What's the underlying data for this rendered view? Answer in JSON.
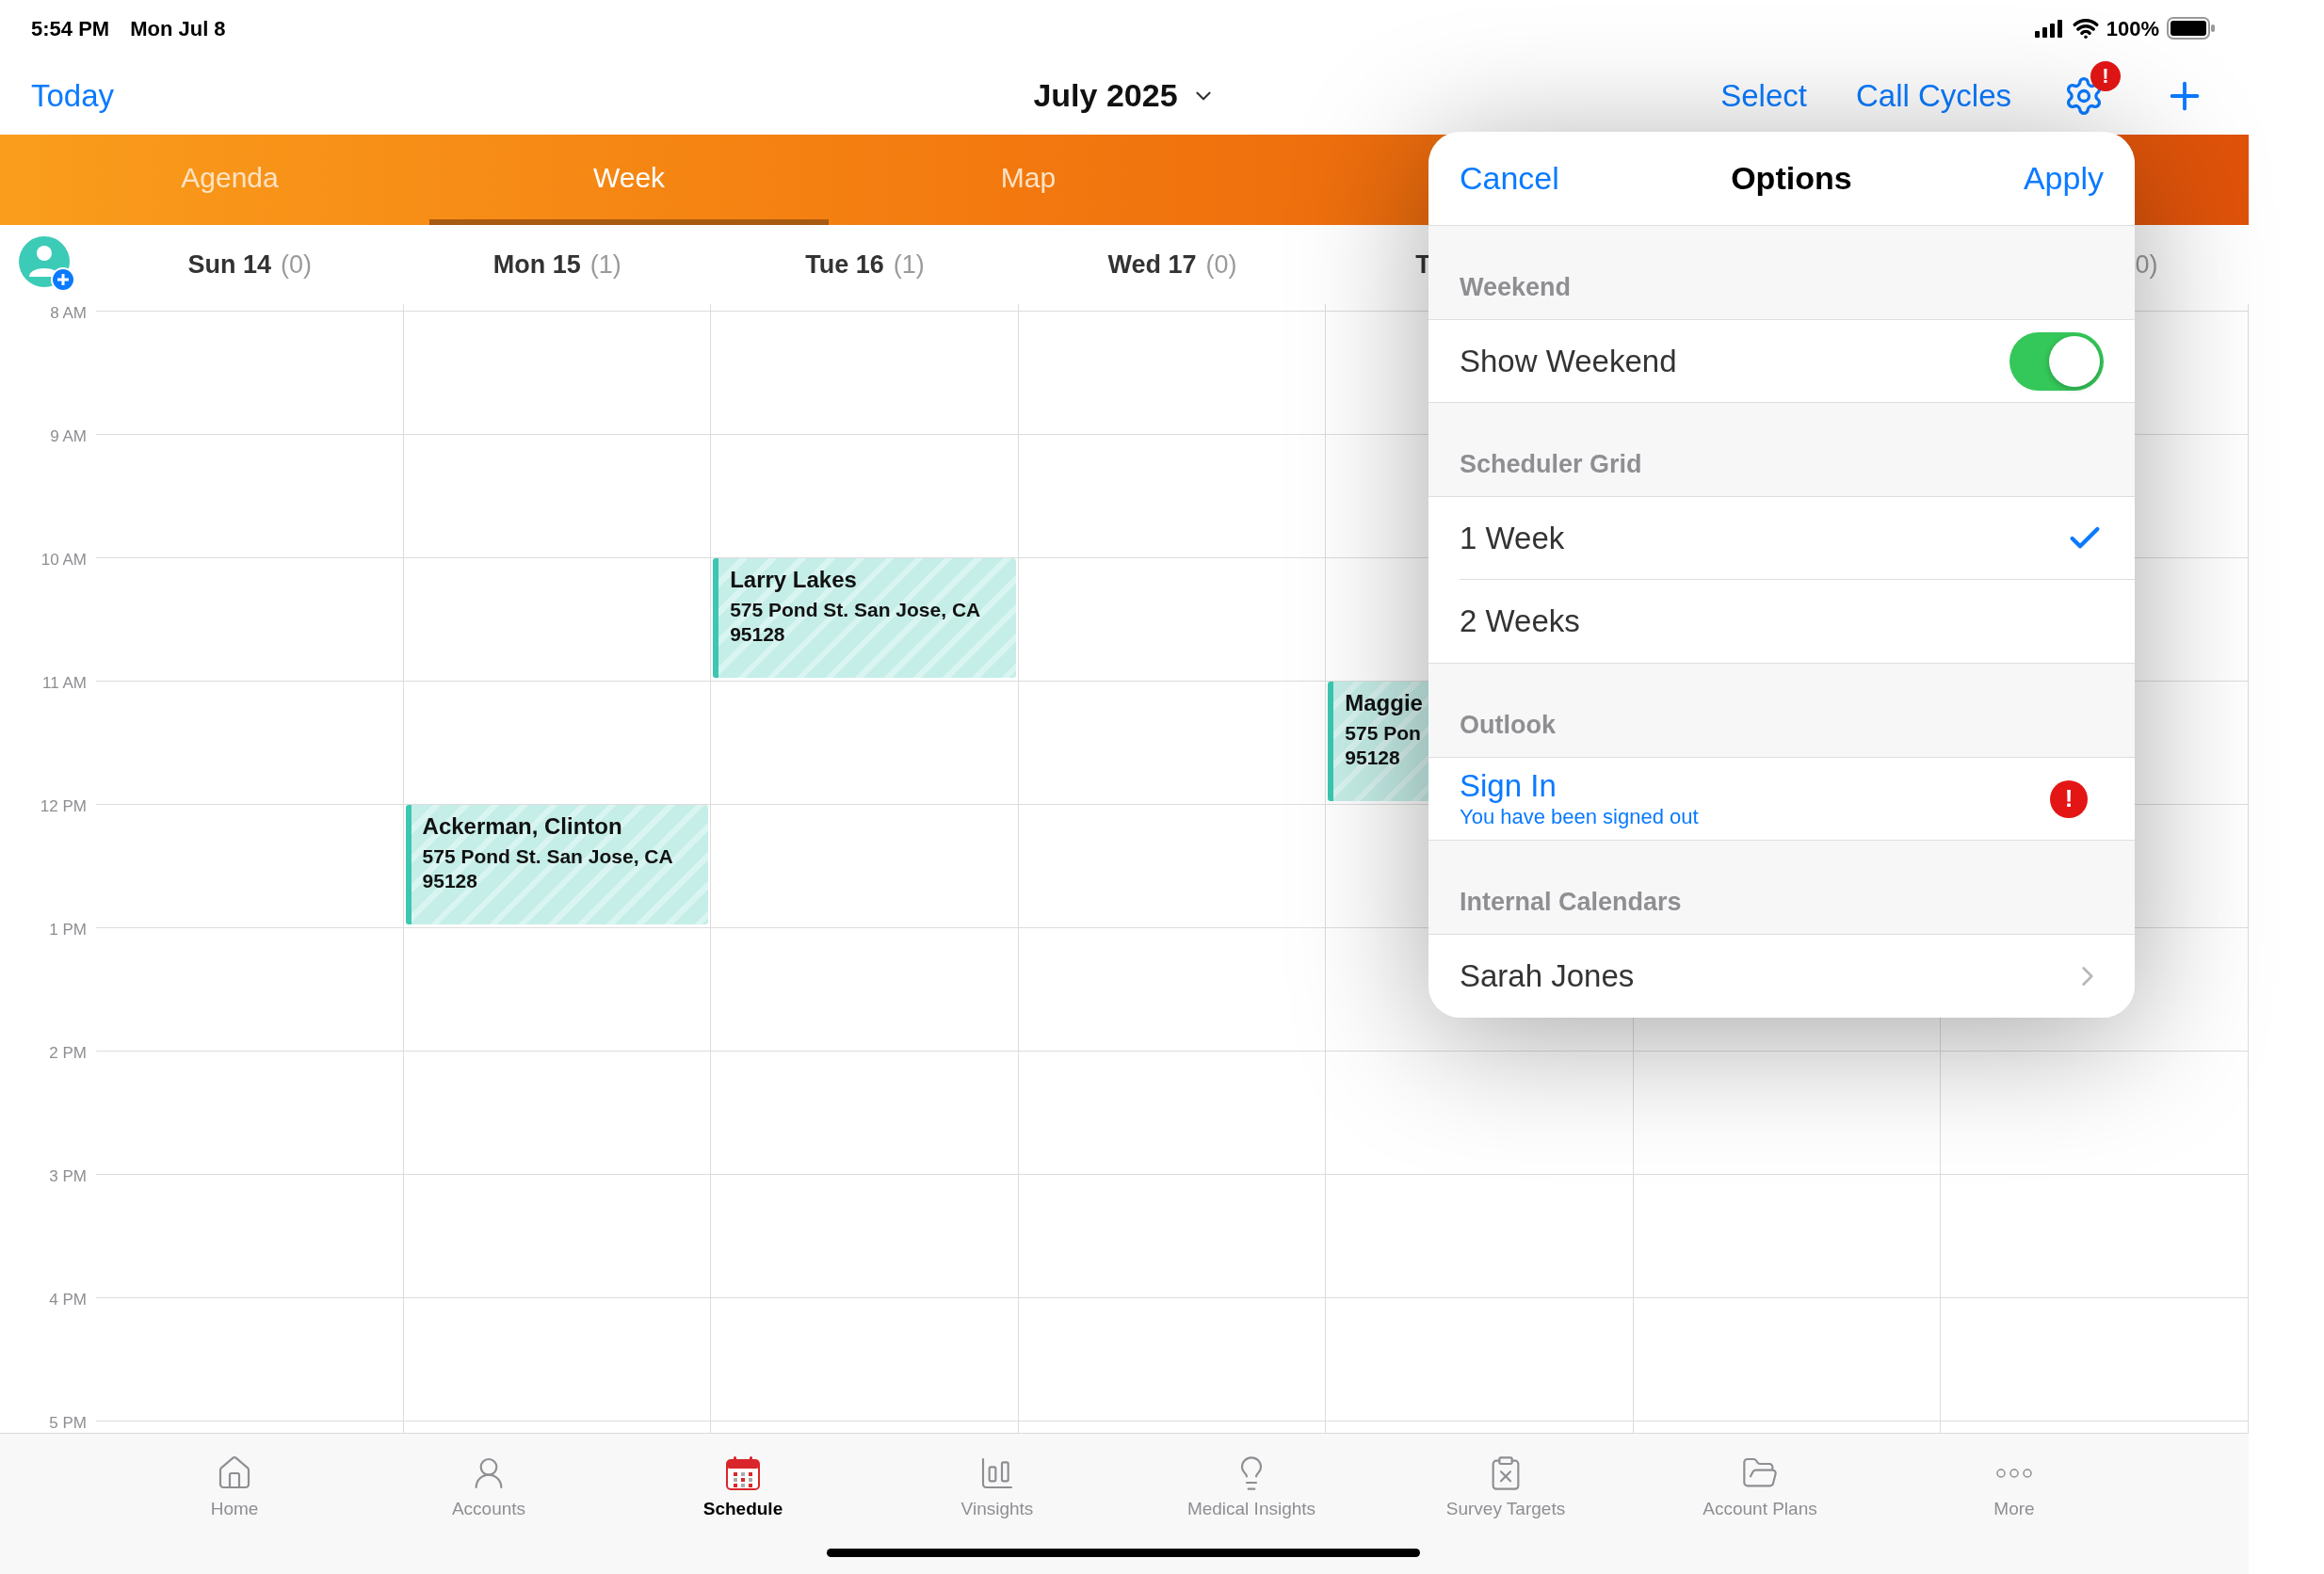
{
  "status_bar": {
    "time": "5:54 PM",
    "date": "Mon Jul 8",
    "battery": "100%"
  },
  "nav": {
    "today": "Today",
    "title": "July 2025",
    "actions": [
      "Select",
      "Call Cycles"
    ],
    "settings_alert": "!"
  },
  "view_tabs": [
    {
      "label": "Agenda",
      "selected": false
    },
    {
      "label": "Week",
      "selected": true
    },
    {
      "label": "Map",
      "selected": false
    }
  ],
  "hours": [
    "8 AM",
    "9 AM",
    "10 AM",
    "11 AM",
    "12 PM",
    "1 PM",
    "2 PM",
    "3 PM",
    "4 PM",
    "5 PM"
  ],
  "days": [
    {
      "kind": "full",
      "label": "Sun 14",
      "count": "(0)"
    },
    {
      "kind": "full",
      "label": "Mon 15",
      "count": "(1)",
      "events": [
        {
          "title": "Ackerman, Clinton",
          "address_lines": [
            "575 Pond St. San Jose, CA",
            "95128"
          ]
        }
      ]
    },
    {
      "kind": "full",
      "label": "Tue 16",
      "count": "(1)",
      "events": [
        {
          "title": "Larry Lakes",
          "address_lines": [
            "575 Pond St. San Jose, CA",
            "95128"
          ]
        }
      ]
    },
    {
      "kind": "full",
      "label": "Wed 17",
      "count": "(0)"
    },
    {
      "kind": "clipped-label",
      "label": "T",
      "events": [
        {
          "title": "Maggie",
          "address_lines": [
            "575 Pon",
            "95128"
          ]
        }
      ]
    },
    {
      "kind": "covered"
    },
    {
      "kind": "clipped-count",
      "count": "0)"
    }
  ],
  "options_popover": {
    "cancel": "Cancel",
    "title": "Options",
    "apply": "Apply",
    "sections": [
      {
        "header": "Weekend",
        "rows": [
          {
            "kind": "toggle",
            "label": "Show Weekend",
            "on": true
          }
        ]
      },
      {
        "header": "Scheduler Grid",
        "rows": [
          {
            "kind": "choice",
            "label": "1 Week",
            "selected": true
          },
          {
            "kind": "choice",
            "label": "2 Weeks",
            "selected": false
          }
        ]
      },
      {
        "header": "Outlook",
        "rows": [
          {
            "kind": "link",
            "label": "Sign In",
            "detail": "You have been signed out",
            "alert": "!"
          }
        ]
      },
      {
        "header": "Internal Calendars",
        "rows": [
          {
            "kind": "disclosure",
            "label": "Sarah Jones"
          }
        ]
      }
    ]
  },
  "tab_bar": [
    {
      "kind": "home",
      "label": "Home",
      "selected": false
    },
    {
      "kind": "accounts",
      "label": "Accounts",
      "selected": false
    },
    {
      "kind": "schedule",
      "label": "Schedule",
      "selected": true
    },
    {
      "kind": "vinsights",
      "label": "Vinsights",
      "selected": false
    },
    {
      "kind": "insights",
      "label": "Medical Insights",
      "selected": false
    },
    {
      "kind": "survey",
      "label": "Survey Targets",
      "selected": false
    },
    {
      "kind": "plans",
      "label": "Account Plans",
      "selected": false
    },
    {
      "kind": "more",
      "label": "More",
      "selected": false
    }
  ]
}
